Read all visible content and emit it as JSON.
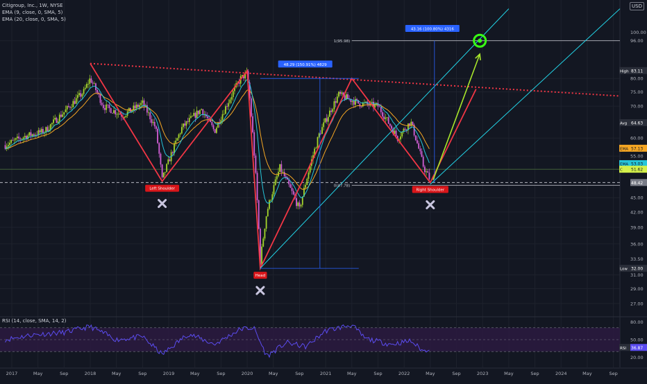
{
  "legend": {
    "title": "Citigroup, Inc., 1W, NYSE",
    "ema9": "EMA (9, close, 0, SMA, 5)",
    "ema20": "EMA (20, close, 0, SMA, 5)",
    "rsi": "RSI (14, close, SMA, 14, 2)"
  },
  "currency": "USD",
  "colors": {
    "background": "#131722",
    "grid": "#1e222d",
    "candle_up": "#a5d62b",
    "candle_down": "#d35fd6",
    "ema9": "#26c6da",
    "ema20": "#f5a623",
    "pattern_red": "#f23645",
    "neckline_dotted": "#f23645",
    "channel": "#22d3e6",
    "arrow_green": "#a8e62b",
    "target_green": "#39ff14",
    "measure_blue": "#2962ff",
    "rsi_line": "#5b4cf0"
  },
  "chart_data": {
    "type": "candlestick",
    "title": "Citigroup, Inc., 1W, NYSE",
    "x_axis": {
      "tick_labels": [
        "2017",
        "May",
        "Sep",
        "2018",
        "May",
        "Sep",
        "2019",
        "May",
        "Sep",
        "2020",
        "May",
        "Sep",
        "2021",
        "May",
        "Sep",
        "2022",
        "May",
        "Sep",
        "2023",
        "May",
        "Sep",
        "2024",
        "May",
        "Sep"
      ]
    },
    "y_axis": {
      "scale": "log",
      "range": [
        25.5,
        110
      ],
      "tick_labels": [
        "100.00",
        "96.00",
        "80.00",
        "75.00",
        "70.00",
        "64.63",
        "60.00",
        "57.13",
        "55.00",
        "53.03",
        "51.62",
        "48.42",
        "45.00",
        "42.00",
        "39.00",
        "36.00",
        "33.50",
        "32.00",
        "31.00",
        "29.00",
        "27.00"
      ],
      "ticks": [
        96,
        80,
        75,
        70,
        60,
        55,
        45,
        42,
        39,
        36,
        33.5,
        31,
        29,
        27
      ]
    },
    "price_badges": [
      {
        "label": "High",
        "value": "83.11",
        "price": 83.11
      },
      {
        "label": "Avg",
        "value": "64.63",
        "price": 64.63
      },
      {
        "label": "EMA",
        "value": "57.13",
        "price": 57.13
      },
      {
        "label": "EMA",
        "value": "53.03",
        "price": 53.03
      },
      {
        "label": "C",
        "value": "51.62",
        "price": 51.62
      },
      {
        "label": "",
        "value": "48.42",
        "price": 48.42
      },
      {
        "label": "Low",
        "value": "32.00",
        "price": 32.0
      }
    ],
    "price_path": [
      [
        "2016-12",
        58.0
      ],
      [
        "2017-03",
        60.5
      ],
      [
        "2017-06",
        62.0
      ],
      [
        "2017-09",
        68.0
      ],
      [
        "2017-12",
        75.0
      ],
      [
        "2018-01",
        80.0
      ],
      [
        "2018-03",
        70.0
      ],
      [
        "2018-06",
        67.0
      ],
      [
        "2018-09",
        71.0
      ],
      [
        "2018-11",
        63.0
      ],
      [
        "2018-12",
        49.0
      ],
      [
        "2019-03",
        63.0
      ],
      [
        "2019-06",
        69.0
      ],
      [
        "2019-08",
        62.0
      ],
      [
        "2019-12",
        80.0
      ],
      [
        "2020-01",
        82.0
      ],
      [
        "2020-03",
        33.0
      ],
      [
        "2020-04",
        42.0
      ],
      [
        "2020-06",
        52.0
      ],
      [
        "2020-09",
        42.5
      ],
      [
        "2020-12",
        61.0
      ],
      [
        "2021-03",
        74.0
      ],
      [
        "2021-06",
        71.0
      ],
      [
        "2021-09",
        70.0
      ],
      [
        "2021-12",
        60.0
      ],
      [
        "2022-02",
        65.0
      ],
      [
        "2022-04",
        52.0
      ],
      [
        "2022-05",
        49.0
      ]
    ],
    "pattern": {
      "name": "Head and Shoulders",
      "labels": [
        "Left Shoulder",
        "Head",
        "Right Shoulder"
      ],
      "points": [
        [
          "2018-01",
          86.0
        ],
        [
          "2018-12",
          48.7
        ],
        [
          "2020-01",
          83.0
        ],
        [
          "2020-03",
          32.0
        ],
        [
          "2021-05",
          80.0
        ],
        [
          "2022-05",
          48.4
        ],
        [
          "2022-12",
          76.0
        ]
      ],
      "neckline": {
        "from": [
          "2018-01",
          86.0
        ],
        "to": [
          "2024-10",
          73.5
        ]
      }
    },
    "annotations": [
      {
        "text": "48.29 (150.91%) 4829",
        "anchor": [
          "2020-12",
          85.5
        ]
      },
      {
        "text": "43.16 (100.80%) 4316",
        "anchor": [
          "2022-05",
          101.5
        ]
      },
      {
        "text": "1(95.98)",
        "price": 95.98
      },
      {
        "text": "0(47.78)",
        "price": 47.78
      }
    ],
    "fib_levels": [
      95.98,
      47.78
    ],
    "target_price": 95.98
  },
  "rsi_chart": {
    "title": "RSI (14, close, SMA, 14, 2)",
    "y_range": [
      15,
      85
    ],
    "tick_labels": [
      "80.00",
      "50.00",
      "20.00"
    ],
    "bands": [
      70,
      30
    ],
    "current": {
      "label": "RSI",
      "value": "36.87",
      "v": 36.87
    },
    "values": [
      [
        "2016-12",
        50
      ],
      [
        "2017-04",
        58
      ],
      [
        "2017-09",
        62
      ],
      [
        "2018-01",
        72
      ],
      [
        "2018-05",
        50
      ],
      [
        "2018-09",
        55
      ],
      [
        "2018-12",
        25
      ],
      [
        "2019-04",
        60
      ],
      [
        "2019-08",
        42
      ],
      [
        "2019-12",
        68
      ],
      [
        "2020-02",
        70
      ],
      [
        "2020-04",
        22
      ],
      [
        "2020-07",
        45
      ],
      [
        "2020-10",
        38
      ],
      [
        "2021-01",
        65
      ],
      [
        "2021-05",
        75
      ],
      [
        "2021-07",
        52
      ],
      [
        "2021-11",
        42
      ],
      [
        "2022-02",
        48
      ],
      [
        "2022-04",
        30
      ],
      [
        "2022-05",
        36.87
      ]
    ]
  }
}
